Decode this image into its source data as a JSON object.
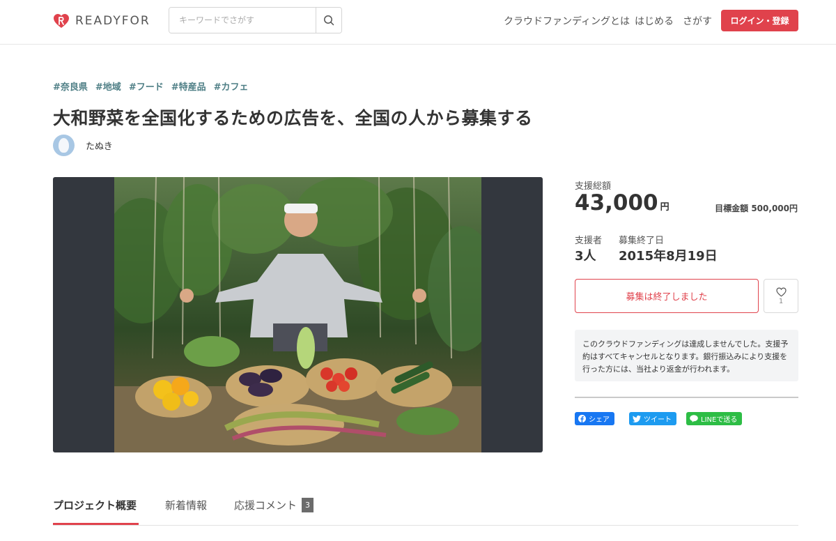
{
  "header": {
    "logo_text": "READYFOR",
    "search_placeholder": "キーワードでさがす",
    "nav": {
      "what": "クラウドファンディングとは",
      "start": "はじめる",
      "find": "さがす"
    },
    "login_label": "ログイン・登録"
  },
  "project": {
    "tags": [
      "#奈良県",
      "#地域",
      "#フード",
      "#特産品",
      "#カフェ"
    ],
    "title": "大和野菜を全国化するための広告を、全国の人から募集する",
    "owner_name": "たぬき"
  },
  "stats": {
    "total_label": "支援総額",
    "total_amount": "43,000",
    "currency": "円",
    "goal": "目標金額 500,000円",
    "supporters_label": "支援者",
    "supporters_value": "3人",
    "end_label": "募集終了日",
    "end_value": "2015年8月19日"
  },
  "actions": {
    "ended_label": "募集は終了しました",
    "favorite_count": "1"
  },
  "notice": "このクラウドファンディングは達成しませんでした。支援予約はすべてキャンセルとなります。銀行振込みにより支援を行った方には、当社より返金が行われます。",
  "share": {
    "facebook": "シェア",
    "twitter": "ツイート",
    "line": "LINEで送る"
  },
  "tabs": {
    "overview": "プロジェクト概要",
    "news": "新着情報",
    "comments": "応援コメント",
    "comments_count": "3"
  },
  "colors": {
    "brand_red": "#e0424c",
    "tag_teal": "#4f7f86",
    "facebook": "#1877f2",
    "twitter": "#1d9bf0",
    "line": "#2dbd45"
  }
}
